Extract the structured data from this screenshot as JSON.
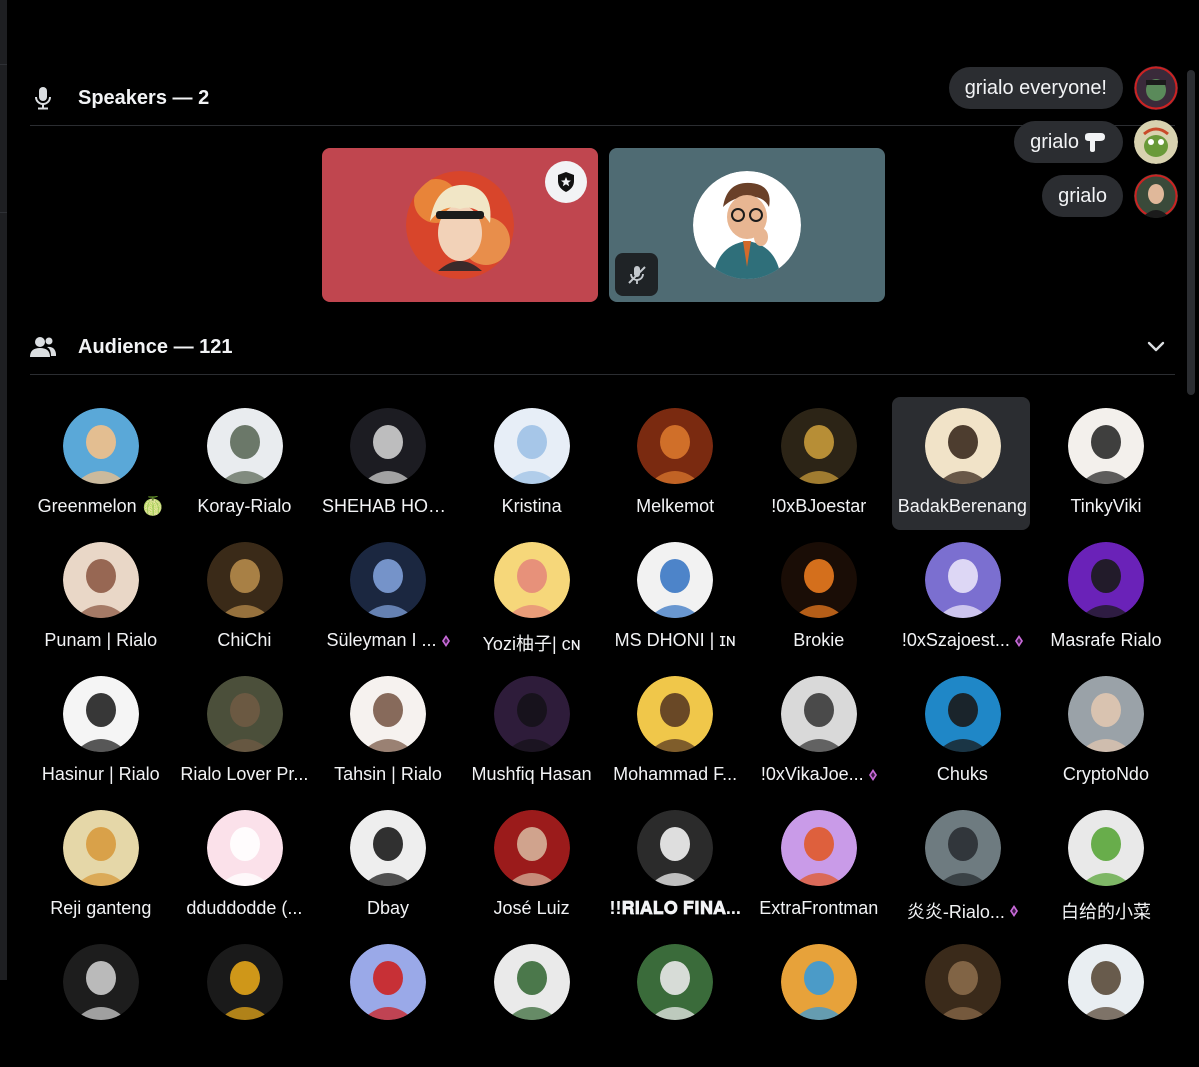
{
  "speakers": {
    "title": "Speakers — 2",
    "tiles": [
      {
        "id": "speaker-1",
        "bg": "#c0464f",
        "badge": "star-shield-icon",
        "muted": false
      },
      {
        "id": "speaker-2",
        "bg": "#4f6b73",
        "badge": "",
        "muted": true
      }
    ]
  },
  "reactions": [
    {
      "text": "grialo everyone!"
    },
    {
      "text": "grialo"
    },
    {
      "text": "grialo"
    }
  ],
  "audience": {
    "title": "Audience — 121",
    "members": [
      {
        "name": "Greenmelon 🍈",
        "bg": "#5aa8d8",
        "fg": "#f2c08a"
      },
      {
        "name": "Koray-Rialo",
        "bg": "#e9ecef",
        "fg": "#5d6b5a"
      },
      {
        "name": "SHEHAB HOS...",
        "bg": "#1c1c22",
        "fg": "#cfcfcf"
      },
      {
        "name": "Kristina",
        "bg": "#e7eef7",
        "fg": "#9fc1e6"
      },
      {
        "name": "Melkemot",
        "bg": "#7a2a10",
        "fg": "#d9772c"
      },
      {
        "name": "!0xBJoestar",
        "bg": "#2c2416",
        "fg": "#c79a3a"
      },
      {
        "name": "BadakBerenang",
        "bg": "#f1e3c8",
        "fg": "#3b2a1e"
      },
      {
        "name": "TinkyViki",
        "bg": "#f3f0ec",
        "fg": "#2b2b2b"
      },
      {
        "name": "Punam | Rialo",
        "bg": "#e9d7c7",
        "fg": "#8e5b46"
      },
      {
        "name": "ChiChi",
        "bg": "#3a2a18",
        "fg": "#b58a4a"
      },
      {
        "name": "Süleyman I ...",
        "bg": "#1b2740",
        "fg": "#7fa0d8"
      },
      {
        "name": "Yozi柚子| ᴄɴ",
        "bg": "#f6d77a",
        "fg": "#e58a7a"
      },
      {
        "name": "MS DHONI | ɪɴ",
        "bg": "#f2f2f2",
        "fg": "#3b78c4"
      },
      {
        "name": "Brokie",
        "bg": "#1a0d06",
        "fg": "#e97a1f"
      },
      {
        "name": "!0xSzajoest...",
        "bg": "#7b6fd0",
        "fg": "#e8e2f8"
      },
      {
        "name": "Masrafe Rialo",
        "bg": "#6a22b8",
        "fg": "#1b1b1b"
      },
      {
        "name": "Hasinur | Rialo",
        "bg": "#f5f5f5",
        "fg": "#222"
      },
      {
        "name": "Rialo Lover Pr...",
        "bg": "#4b4f3a",
        "fg": "#6f5a44"
      },
      {
        "name": "Tahsin | Rialo",
        "bg": "#f6f2ef",
        "fg": "#7b5b4a"
      },
      {
        "name": "Mushfiq Hasan",
        "bg": "#2e1c3a",
        "fg": "#15121a"
      },
      {
        "name": "Mohammad F...",
        "bg": "#f0c74a",
        "fg": "#5a3a22"
      },
      {
        "name": "!0xVikaJoe...",
        "bg": "#d9d9d9",
        "fg": "#3a3a3a"
      },
      {
        "name": "Chuks",
        "bg": "#1f87c7",
        "fg": "#1a1a1a"
      },
      {
        "name": "CryptoNdo",
        "bg": "#9aa2a8",
        "fg": "#e0c6b0"
      },
      {
        "name": "Reji ganteng",
        "bg": "#e5d7a8",
        "fg": "#d79b3e"
      },
      {
        "name": "dduddodde (...",
        "bg": "#fbe1ea",
        "fg": "#ffffff"
      },
      {
        "name": "Dbay",
        "bg": "#eeeeee",
        "fg": "#1b1b1b"
      },
      {
        "name": "José Luiz",
        "bg": "#9b1b1b",
        "fg": "#d6b29a"
      },
      {
        "name": "!!𝐑𝐈𝐀𝐋𝐎 𝐅𝐈𝐍𝐀...",
        "bg": "#2b2b2b",
        "fg": "#f2f2f2"
      },
      {
        "name": "ExtraFrontman",
        "bg": "#c99be8",
        "fg": "#e05a2a"
      },
      {
        "name": "炎炎-Rialo...",
        "bg": "#6e7b80",
        "fg": "#2a2f33"
      },
      {
        "name": "白给的小菜",
        "bg": "#e9e9e9",
        "fg": "#5aa63a"
      },
      {
        "name": "",
        "bg": "#1d1d1d",
        "fg": "#cccccc"
      },
      {
        "name": "",
        "bg": "#1a1a1a",
        "fg": "#e3a51a"
      },
      {
        "name": "",
        "bg": "#9aa9e8",
        "fg": "#c22"
      },
      {
        "name": "",
        "bg": "#eaeaea",
        "fg": "#3a6b3a"
      },
      {
        "name": "",
        "bg": "#3a6b3a",
        "fg": "#e9e9e9"
      },
      {
        "name": "",
        "bg": "#e7a23a",
        "fg": "#3a9ad8"
      },
      {
        "name": "",
        "bg": "#3a2a1a",
        "fg": "#8a6a4a"
      },
      {
        "name": "",
        "bg": "#e9eef2",
        "fg": "#5a4a3a"
      }
    ],
    "gem_members": [
      10,
      14,
      21,
      30
    ],
    "hovered_index": 6,
    "bold_index": 28
  },
  "colors": {
    "accent_gem": "#c86ad8"
  }
}
